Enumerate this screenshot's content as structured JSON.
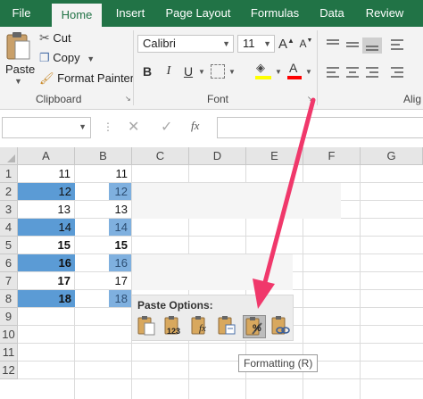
{
  "tabs": [
    {
      "label": "File",
      "active": false
    },
    {
      "label": "Home",
      "active": true
    },
    {
      "label": "Insert",
      "active": false
    },
    {
      "label": "Page Layout",
      "active": false
    },
    {
      "label": "Formulas",
      "active": false
    },
    {
      "label": "Data",
      "active": false
    },
    {
      "label": "Review",
      "active": false
    }
  ],
  "clipboard": {
    "paste_label": "Paste",
    "cut_label": "Cut",
    "copy_label": "Copy",
    "format_painter_label": "Format Painter",
    "group_label": "Clipboard"
  },
  "font": {
    "family_value": "Calibri",
    "size_value": "11",
    "group_label": "Font",
    "bold_glyph": "B",
    "italic_glyph": "I",
    "underline_glyph": "U",
    "grow_glyph": "A",
    "shrink_glyph": "A",
    "font_color_glyph": "A"
  },
  "alignment": {
    "group_label_partial": "Alig"
  },
  "formula_bar": {
    "fx_label": "fx"
  },
  "grid": {
    "columns": [
      "A",
      "B",
      "C",
      "D",
      "E",
      "F",
      "G"
    ],
    "rows": [
      "1",
      "2",
      "3",
      "4",
      "5",
      "6",
      "7",
      "8",
      "9",
      "10",
      "11",
      "12"
    ],
    "col_a_values": [
      "11",
      "12",
      "13",
      "14",
      "15",
      "16",
      "17",
      "18"
    ],
    "col_b_values": [
      "11",
      "12",
      "13",
      "14",
      "15",
      "16",
      "17",
      "18"
    ]
  },
  "paste_options": {
    "title": "Paste Options:",
    "values_badge": "123",
    "formulas_badge": "fx",
    "formatting_badge": "%",
    "tooltip": "Formatting (R)"
  },
  "colors": {
    "excel_green": "#217346",
    "highlight_blue": "#5b9bd5",
    "arrow_pink": "#f0386b"
  }
}
